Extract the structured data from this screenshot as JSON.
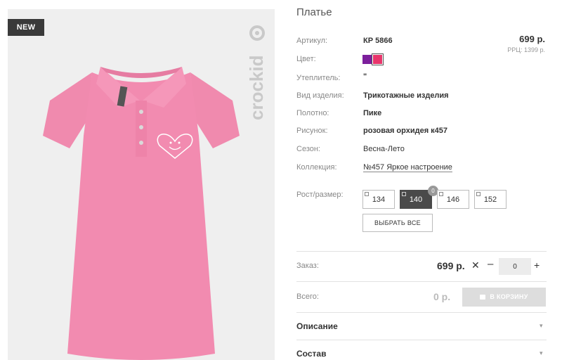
{
  "product": {
    "badge": "NEW",
    "brand": "crockid",
    "title": "Платье"
  },
  "price": {
    "main": "699 р.",
    "rrc": "РРЦ: 1399 р."
  },
  "colors": [
    "#7c1f9c",
    "#e8356b"
  ],
  "attributes": {
    "article_label": "Артикул:",
    "article_value": "КР 5866",
    "color_label": "Цвет:",
    "insulation_label": "Утеплитель:",
    "insulation_value": "\"",
    "type_label": "Вид изделия:",
    "type_value": "Трикотажные изделия",
    "fabric_label": "Полотно:",
    "fabric_value": "Пике",
    "pattern_label": "Рисунок:",
    "pattern_value": "розовая орхидея к457",
    "season_label": "Сезон:",
    "season_value": "Весна-Лето",
    "collection_label": "Коллекция:",
    "collection_value": "№457 Яркое настроение"
  },
  "sizes": {
    "label": "Рост/размер:",
    "options": [
      "134",
      "140",
      "146",
      "152"
    ],
    "selected": "140",
    "selected_count": "0",
    "select_all": "ВЫБРАТЬ ВСЕ"
  },
  "order": {
    "label": "Заказ:",
    "price": "699 р.",
    "times": "✕",
    "minus": "–",
    "plus": "+",
    "quantity": "0"
  },
  "total": {
    "label": "Всего:",
    "value": "0 р.",
    "cart_button": "В КОРЗИНУ"
  },
  "accordion": {
    "description": "Описание",
    "composition": "Состав",
    "arrow": "▾"
  },
  "dress_color": "#f28bb0"
}
